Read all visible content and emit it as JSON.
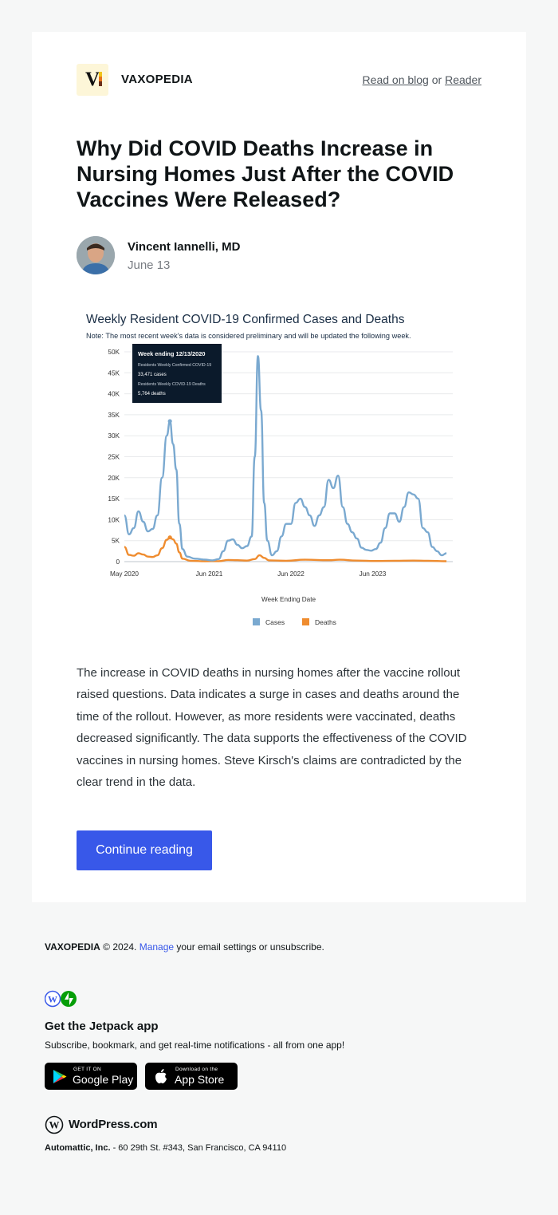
{
  "site": {
    "name": "VAXOPEDIA",
    "logo_letter": "V"
  },
  "header": {
    "read_on_blog": "Read on blog",
    "or": "or",
    "reader": "Reader"
  },
  "post": {
    "title": "Why Did COVID Deaths Increase in Nursing Homes Just After the COVID Vaccines Were Released?",
    "author": "Vincent Iannelli, MD",
    "date": "June 13",
    "excerpt": "The increase in COVID deaths in nursing homes after the vaccine rollout raised questions. Data indicates a surge in cases and deaths around the time of the rollout. However, as more residents were vaccinated, deaths decreased significantly. The data supports the effectiveness of the COVID vaccines in nursing homes. Steve Kirsch's claims are contradicted by the clear trend in the data.",
    "cta": "Continue reading"
  },
  "chart_data": {
    "type": "line",
    "title": "Weekly Resident COVID-19 Confirmed Cases and Deaths",
    "subtitle": "Note: The most recent week's data is considered preliminary and will be updated the following week.",
    "xlabel": "Week Ending Date",
    "ylabel": "",
    "x_ticks": [
      "May 2020",
      "Jun 2021",
      "Jun 2022",
      "Jun 2023"
    ],
    "y_ticks": [
      "0",
      "5K",
      "10K",
      "15K",
      "20K",
      "25K",
      "30K",
      "35K",
      "40K",
      "45K",
      "50K"
    ],
    "ylim": [
      0,
      50000
    ],
    "xlim": [
      "2020-05-24",
      "2024-05-26"
    ],
    "legend": "bottom",
    "grid": true,
    "tooltip": {
      "title": "Week ending 12/13/2020",
      "line1": "Residents Weekly Confirmed COVID-19",
      "line2": "33,471 cases",
      "line3": "Residents Weekly COVID-19 Deaths",
      "line4": "5,764 deaths"
    },
    "series": [
      {
        "name": "Cases",
        "color": "#7aa9d0",
        "points": [
          [
            "2020-05-24",
            11000
          ],
          [
            "2020-06-14",
            6500
          ],
          [
            "2020-07-05",
            8000
          ],
          [
            "2020-07-26",
            12000
          ],
          [
            "2020-08-16",
            9500
          ],
          [
            "2020-09-06",
            7200
          ],
          [
            "2020-09-27",
            7800
          ],
          [
            "2020-10-18",
            11000
          ],
          [
            "2020-11-08",
            20000
          ],
          [
            "2020-11-29",
            30000
          ],
          [
            "2020-12-13",
            33471
          ],
          [
            "2020-12-27",
            28000
          ],
          [
            "2021-01-10",
            22000
          ],
          [
            "2021-01-24",
            9000
          ],
          [
            "2021-02-07",
            3000
          ],
          [
            "2021-02-28",
            1200
          ],
          [
            "2021-04-04",
            700
          ],
          [
            "2021-05-16",
            500
          ],
          [
            "2021-06-20",
            300
          ],
          [
            "2021-07-18",
            600
          ],
          [
            "2021-08-08",
            2500
          ],
          [
            "2021-08-29",
            5000
          ],
          [
            "2021-09-19",
            5300
          ],
          [
            "2021-10-10",
            4000
          ],
          [
            "2021-10-31",
            3200
          ],
          [
            "2021-11-21",
            3700
          ],
          [
            "2021-12-12",
            6000
          ],
          [
            "2021-12-26",
            25000
          ],
          [
            "2022-01-09",
            49000
          ],
          [
            "2022-01-23",
            36000
          ],
          [
            "2022-02-06",
            14000
          ],
          [
            "2022-02-20",
            5000
          ],
          [
            "2022-03-13",
            1500
          ],
          [
            "2022-04-03",
            2500
          ],
          [
            "2022-04-24",
            6000
          ],
          [
            "2022-05-15",
            9000
          ],
          [
            "2022-06-05",
            9000
          ],
          [
            "2022-06-26",
            14000
          ],
          [
            "2022-07-17",
            15000
          ],
          [
            "2022-08-07",
            13000
          ],
          [
            "2022-08-28",
            11000
          ],
          [
            "2022-09-18",
            8500
          ],
          [
            "2022-10-09",
            11000
          ],
          [
            "2022-10-30",
            13000
          ],
          [
            "2022-11-20",
            19500
          ],
          [
            "2022-12-11",
            17500
          ],
          [
            "2023-01-01",
            20500
          ],
          [
            "2023-01-22",
            13000
          ],
          [
            "2023-02-12",
            9000
          ],
          [
            "2023-03-05",
            7000
          ],
          [
            "2023-03-26",
            5500
          ],
          [
            "2023-04-16",
            3300
          ],
          [
            "2023-05-07",
            2800
          ],
          [
            "2023-05-28",
            2600
          ],
          [
            "2023-06-18",
            3000
          ],
          [
            "2023-07-09",
            4500
          ],
          [
            "2023-07-30",
            8000
          ],
          [
            "2023-08-20",
            11500
          ],
          [
            "2023-09-10",
            11500
          ],
          [
            "2023-10-01",
            9500
          ],
          [
            "2023-10-22",
            13000
          ],
          [
            "2023-11-12",
            16500
          ],
          [
            "2023-12-03",
            16000
          ],
          [
            "2023-12-24",
            15000
          ],
          [
            "2024-01-14",
            8000
          ],
          [
            "2024-02-04",
            7000
          ],
          [
            "2024-02-25",
            3500
          ],
          [
            "2024-03-17",
            2500
          ],
          [
            "2024-04-07",
            1500
          ],
          [
            "2024-04-28",
            2000
          ]
        ]
      },
      {
        "name": "Deaths",
        "color": "#ef8c2f",
        "points": [
          [
            "2020-05-24",
            3500
          ],
          [
            "2020-06-14",
            1600
          ],
          [
            "2020-07-05",
            1400
          ],
          [
            "2020-07-26",
            2000
          ],
          [
            "2020-08-16",
            1700
          ],
          [
            "2020-09-06",
            1200
          ],
          [
            "2020-09-27",
            1100
          ],
          [
            "2020-10-18",
            1500
          ],
          [
            "2020-11-08",
            3200
          ],
          [
            "2020-11-29",
            5200
          ],
          [
            "2020-12-13",
            5764
          ],
          [
            "2020-12-27",
            5300
          ],
          [
            "2021-01-10",
            4300
          ],
          [
            "2021-01-24",
            2200
          ],
          [
            "2021-02-07",
            700
          ],
          [
            "2021-03-14",
            200
          ],
          [
            "2021-05-16",
            100
          ],
          [
            "2021-07-18",
            120
          ],
          [
            "2021-08-29",
            400
          ],
          [
            "2021-10-10",
            350
          ],
          [
            "2021-11-21",
            250
          ],
          [
            "2021-12-26",
            600
          ],
          [
            "2022-01-16",
            1500
          ],
          [
            "2022-02-06",
            900
          ],
          [
            "2022-02-27",
            300
          ],
          [
            "2022-05-15",
            200
          ],
          [
            "2022-08-07",
            450
          ],
          [
            "2022-11-20",
            350
          ],
          [
            "2023-01-08",
            450
          ],
          [
            "2023-03-26",
            250
          ],
          [
            "2023-06-18",
            150
          ],
          [
            "2023-09-10",
            200
          ],
          [
            "2023-12-03",
            250
          ],
          [
            "2024-02-04",
            200
          ],
          [
            "2024-04-28",
            100
          ]
        ]
      }
    ]
  },
  "footer": {
    "brand": "VAXOPEDIA",
    "copyright": "© 2024.",
    "manage": "Manage",
    "rest": "your email settings or unsubscribe.",
    "jetpack_title": "Get the Jetpack app",
    "jetpack_sub": "Subscribe, bookmark, and get real-time notifications - all from one app!",
    "google_small": "GET IT ON",
    "google_big": "Google Play",
    "apple_small": "Download on the",
    "apple_big": "App Store",
    "wordpress": "WordPress.com",
    "company": "Automattic, Inc.",
    "address": "- 60 29th St. #343, San Francisco, CA 94110"
  },
  "colors": {
    "accent": "#3858e9",
    "background": "#f6f7f7",
    "card": "#ffffff"
  }
}
